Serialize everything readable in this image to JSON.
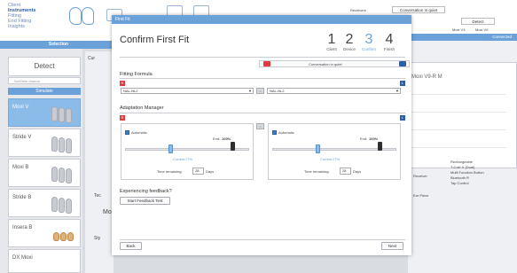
{
  "left_menu": [
    "Client",
    "Instruments",
    "Fitting",
    "End Fitting",
    "Insights"
  ],
  "left_menu_active": "Instruments",
  "selection_label": "Selection",
  "sidebar": {
    "detect_label": "Detect",
    "nowhite_label": "NoWhite Alarma",
    "simulate_label": "Simulate",
    "devices": [
      {
        "name": "Moxi V",
        "selected": true
      },
      {
        "name": "Stride V",
        "selected": false
      },
      {
        "name": "Moxi B",
        "selected": false
      },
      {
        "name": "Stride B",
        "selected": false
      },
      {
        "name": "Insera B",
        "selected": false
      },
      {
        "name": "DX Moxi",
        "selected": false
      }
    ]
  },
  "mid_panel": {
    "label_cur": "Cur",
    "label_tec": "Tec",
    "label_mo": "Mo",
    "label_sty": "Sty"
  },
  "right_panel": {
    "top_label": "Receivers",
    "conv_label": "Conversation in quiet",
    "detect_label": "Detect",
    "moxi_v3": "Moxi V3",
    "moxi_v9": "Moxi V9",
    "connect_label": "Connected",
    "chart_title": "Moxi V9-R M",
    "receiver_label": "Receiver",
    "earpiece_label": "Ear Piece",
    "rechargeable": "Rechargeable",
    "rech_detail": "T-Coil/ X (Dual)",
    "button": "Multi Function Button",
    "bluetooth": "Bluetooth R",
    "tap": "Tap Control"
  },
  "modal": {
    "titlebar": "First Fit",
    "heading": "Confirm First Fit",
    "steps": [
      {
        "num": "1",
        "label": "Client"
      },
      {
        "num": "2",
        "label": "Device"
      },
      {
        "num": "3",
        "label": "Confirm"
      },
      {
        "num": "4",
        "label": "Finish"
      }
    ],
    "active_step": 2,
    "program_label": "Conversation in quiet",
    "fitting_formula_title": "Fitting Formula",
    "formula_left": "NAL-NL2",
    "formula_right": "NAL-NL2",
    "adaptation_title": "Adaptation Manager",
    "left": {
      "automatic": "Automatic",
      "end_label": "End:",
      "end_value": "100%",
      "current_label": "Current:",
      "current_value": "77%",
      "time_label": "Time remaining:",
      "time_value": "28",
      "days": "Days"
    },
    "right": {
      "automatic": "Automatic",
      "end_label": "End:",
      "end_value": "100%",
      "current_label": "Current:",
      "current_value": "77%",
      "time_label": "Time remaining:",
      "time_value": "28",
      "days": "Days"
    },
    "feedback_title": "Experiencing feedback?",
    "feedback_button": "Start Feedback Test",
    "back_button": "Back",
    "next_button": "Next"
  },
  "colors": {
    "accent": "#6aa1d9",
    "left_ear": "#e0393e",
    "right_ear": "#2d5fa8"
  },
  "adaptation": {
    "current_fraction": 0.77,
    "end_fraction": 1.0
  }
}
